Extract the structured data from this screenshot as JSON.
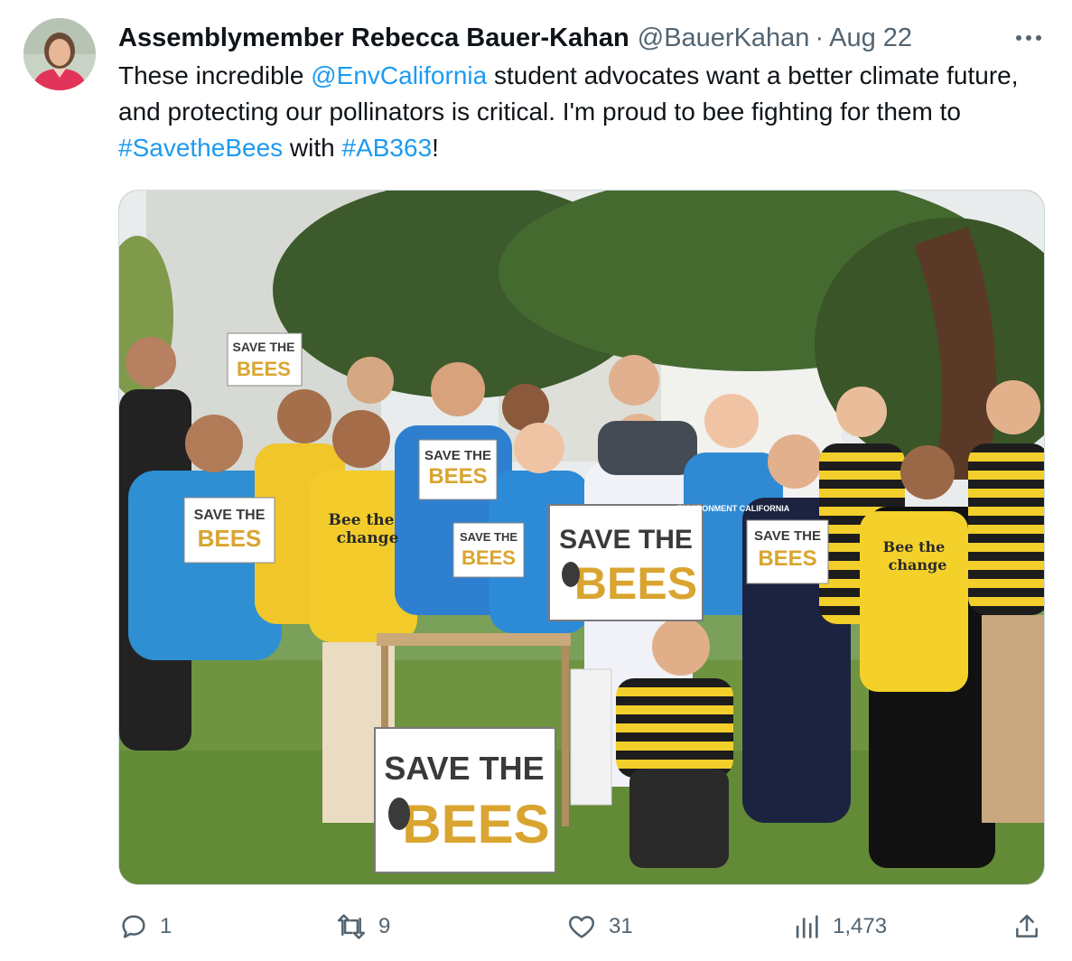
{
  "author": {
    "name": "Assemblymember Rebecca Bauer-Kahan",
    "handle": "@BauerKahan",
    "separator": "·",
    "date": "Aug 22"
  },
  "tweet": {
    "segments": [
      {
        "text": "These incredible ",
        "link": false
      },
      {
        "text": "@EnvCalifornia",
        "link": true
      },
      {
        "text": " student advocates want a better climate future, and protecting our pollinators is critical. I'm proud to bee fighting for them to ",
        "link": false
      },
      {
        "text": "#SavetheBees",
        "link": true
      },
      {
        "text": " with ",
        "link": false
      },
      {
        "text": "#AB363",
        "link": true
      },
      {
        "text": "!",
        "link": false
      }
    ]
  },
  "photo": {
    "signs": {
      "line1": "SAVE",
      "line1b": "THE",
      "line2": "BEES"
    },
    "shirt_text": {
      "line1": "Bee the",
      "line2": "change"
    },
    "banner_text": "ENVIRONMENT CALIFORNIA"
  },
  "actions": {
    "reply_count": "1",
    "retweet_count": "9",
    "like_count": "31",
    "views_count": "1,473"
  },
  "icons": {
    "more": "more-icon",
    "reply": "reply-icon",
    "retweet": "retweet-icon",
    "like": "heart-icon",
    "views": "views-icon",
    "share": "share-icon"
  },
  "colors": {
    "link": "#1d9bf0",
    "secondary": "#536471",
    "sign_gold": "#d9a530",
    "sign_dark": "#3a3a3a"
  }
}
